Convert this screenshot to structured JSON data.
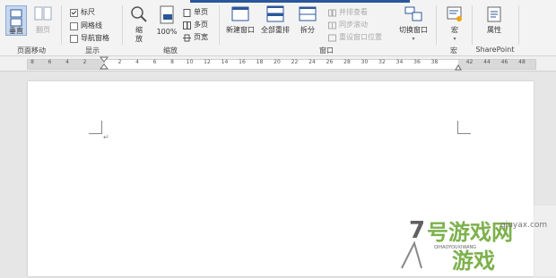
{
  "ribbon": {
    "page_movement": {
      "vertical_label": "垂直",
      "side_label": "翻页",
      "group_label": "页面移动"
    },
    "show": {
      "ruler_label": "标尺",
      "ruler_checked": true,
      "gridlines_label": "网格线",
      "gridlines_checked": false,
      "nav_pane_label": "导航窗格",
      "nav_pane_checked": false,
      "group_label": "显示"
    },
    "zoom": {
      "zoom_label": "缩放",
      "hundred_label": "100%",
      "one_page_label": "单页",
      "multi_page_label": "多页",
      "page_width_label": "页宽",
      "group_label": "缩放"
    },
    "window": {
      "new_window_label": "新建窗口",
      "arrange_all_label": "全部重排",
      "split_label": "拆分",
      "side_by_side_label": "并排查看",
      "sync_scroll_label": "同步滚动",
      "reset_pos_label": "重设窗口位置",
      "switch_label": "切换窗口",
      "group_label": "窗口"
    },
    "macro": {
      "macro_label": "宏",
      "group_label": "宏"
    },
    "sharepoint": {
      "props_label": "属性",
      "group_label": "SharePoint"
    }
  },
  "ruler": {
    "ticks": [
      "8",
      "6",
      "4",
      "2",
      "",
      "2",
      "4",
      "6",
      "8",
      "10",
      "12",
      "14",
      "16",
      "18",
      "20",
      "22",
      "24",
      "26",
      "28",
      "30",
      "32",
      "34",
      "36",
      "38",
      "",
      "42",
      "44",
      "46",
      "48"
    ]
  },
  "colors": {
    "accent": "#2b579a",
    "ribbon_bg": "#f3f3f3",
    "page_bg": "#ffffff",
    "canvas_bg": "#e6e6e6"
  },
  "document": {
    "cursor_mark": "↵"
  },
  "watermark": {
    "site": "7号游戏网",
    "game_label": "游戏",
    "domain": "qiuyax.com",
    "pinyin": "QIHAOYOUXIWANG"
  }
}
